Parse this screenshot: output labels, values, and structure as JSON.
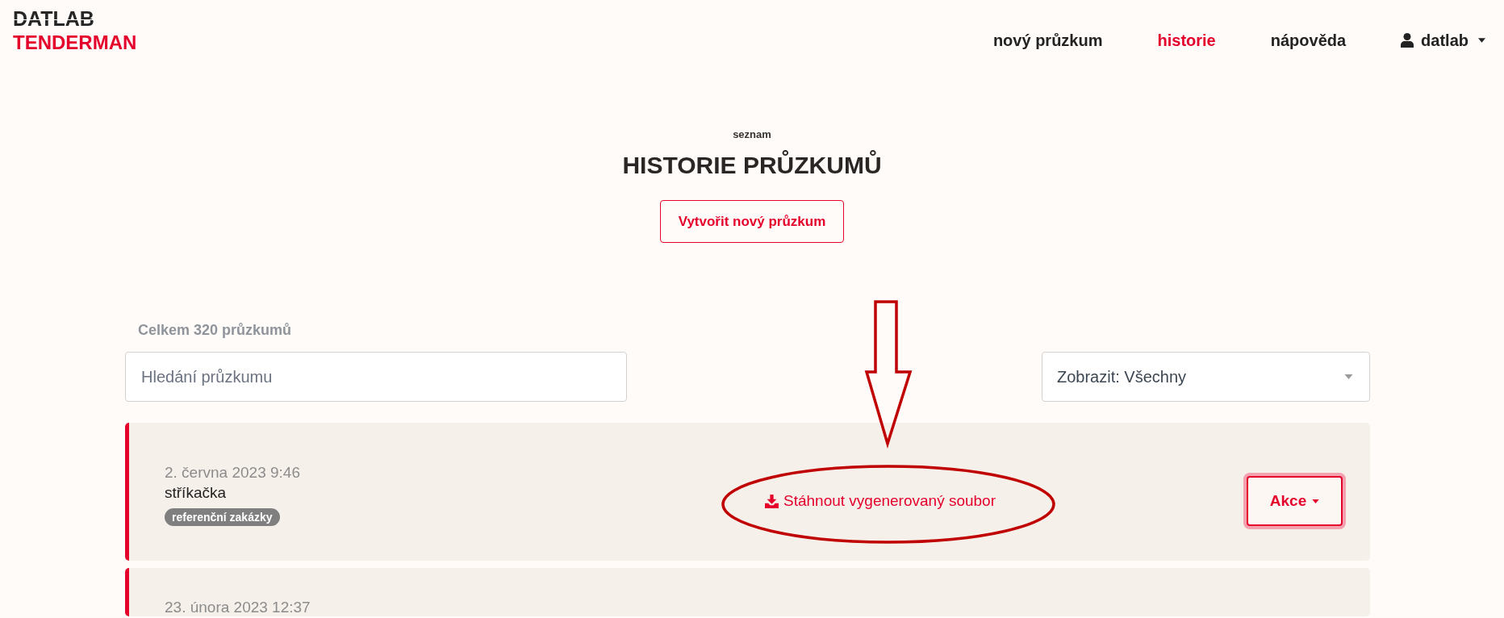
{
  "logo": {
    "top": "DATLAB",
    "bottom": "TENDERMAN"
  },
  "nav": {
    "items": [
      {
        "label": "nový průzkum",
        "selected": false
      },
      {
        "label": "historie",
        "selected": true
      },
      {
        "label": "nápověda",
        "selected": false
      }
    ],
    "user": {
      "name": "datlab"
    }
  },
  "header": {
    "eyebrow": "seznam",
    "title": "HISTORIE PRŮZKUMŮ",
    "create_button": "Vytvořit nový průzkum"
  },
  "list": {
    "count": "Celkem 320 průzkumů",
    "search": {
      "placeholder": "Hledání průzkumu"
    },
    "filter": {
      "value": "Zobrazit: Všechny"
    },
    "surveys": [
      {
        "date": "2. června 2023 9:46",
        "name": "stříkačka",
        "tags": [
          "referenční zakázky"
        ],
        "download": "Stáhnout vygenerovaný soubor",
        "action": {
          "label": "Akce",
          "focused": true
        }
      },
      {
        "date": "23. února 2023 12:37"
      }
    ]
  }
}
